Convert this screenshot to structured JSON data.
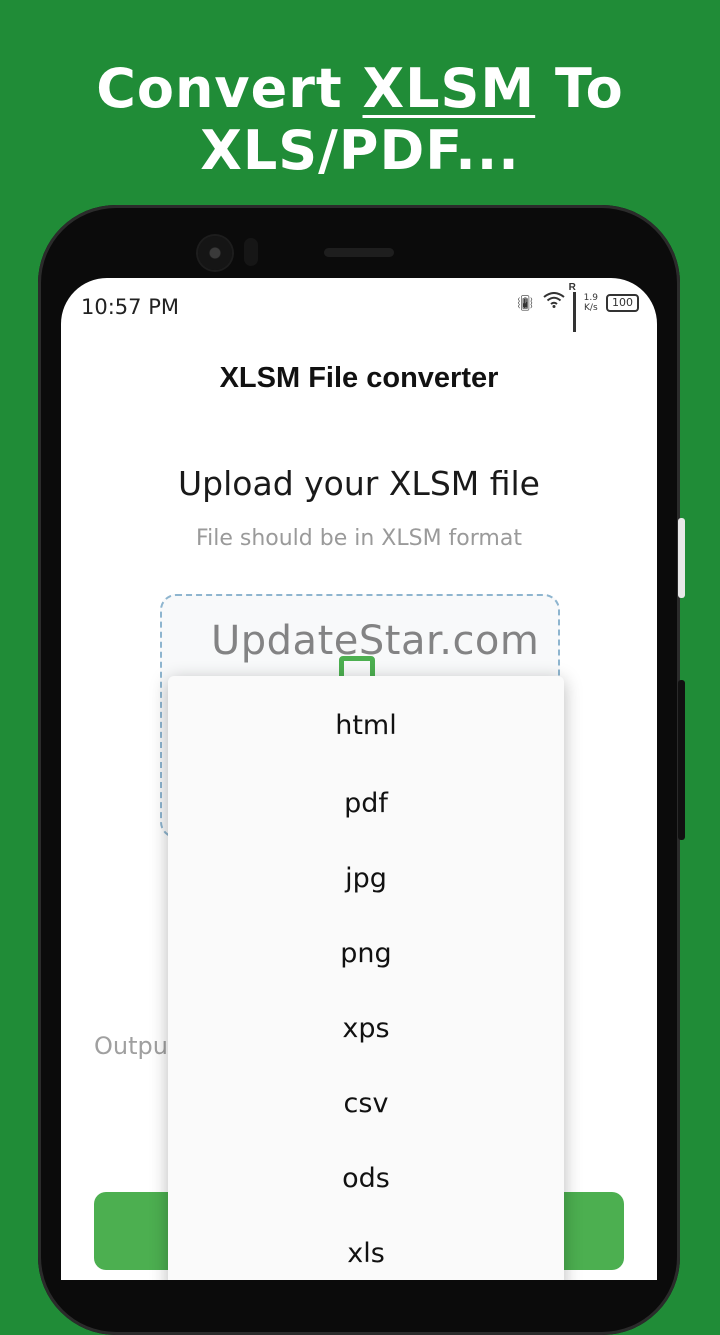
{
  "banner": {
    "line1_prefix": "Convert ",
    "line1_highlight": "XLSM",
    "line1_suffix": " To",
    "line2": "XLS/PDF..."
  },
  "status_bar": {
    "time": "10:57 PM",
    "network_type": "R",
    "speed_value": "1.9",
    "speed_unit": "K/s",
    "battery": "100"
  },
  "app": {
    "title": "XLSM File converter",
    "upload_title": "Upload your XLSM file",
    "upload_subtitle": "File should be in XLSM format",
    "output_label": "Outpu"
  },
  "watermark": "UpdateStar.com",
  "dropdown": {
    "options": [
      "html",
      "pdf",
      "jpg",
      "png",
      "xps",
      "csv",
      "ods",
      "xls"
    ]
  },
  "colors": {
    "background": "#208c37",
    "accent_green": "#4caf50",
    "dashed_border": "#8eb5cf"
  },
  "icons": [
    "vibrate-icon",
    "wifi-icon",
    "signal-icon",
    "battery-icon",
    "file-icon"
  ]
}
